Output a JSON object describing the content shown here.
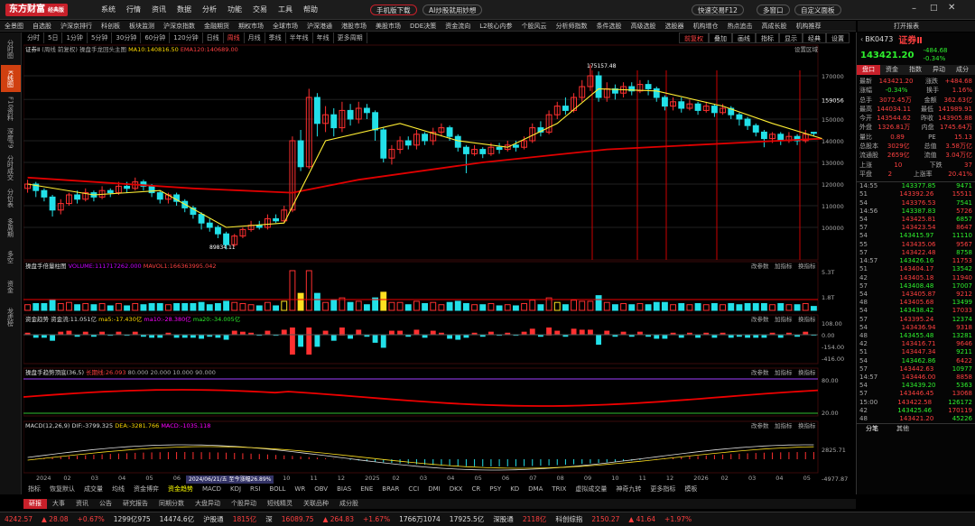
{
  "app": {
    "logo": "东方财富",
    "logo_sub": "经典版"
  },
  "menu": [
    "系统",
    "行情",
    "资讯",
    "数据",
    "分析",
    "功能",
    "交易",
    "工具",
    "帮助"
  ],
  "toolbar": {
    "mobile": "手机版下载",
    "ai": "AI炒股就用妙想",
    "trade_search": "快速交易F12",
    "multi_window": "多窗口",
    "custom": "自定义面板"
  },
  "nav": [
    "全景图",
    "自选股",
    "沪深京排行",
    "科创板",
    "板块监测",
    "沪深京指数",
    "金融期货",
    "期权市场",
    "全球市场",
    "沪深港通",
    "港股市场",
    "美股市场",
    "DDE决策",
    "资金流向",
    "L2核心内参",
    "个股风云",
    "分析师指数",
    "条件选股",
    "高级选股",
    "选股器",
    "机构增仓",
    "热点追击",
    "高成长股",
    "机构推荐"
  ],
  "open_report": "打开报表",
  "timeframes": [
    {
      "label": "分时",
      "on": false
    },
    {
      "label": "5日",
      "on": false
    },
    {
      "label": "1分钟",
      "on": false
    },
    {
      "label": "5分钟",
      "on": false
    },
    {
      "label": "30分钟",
      "on": false
    },
    {
      "label": "60分钟",
      "on": false
    },
    {
      "label": "120分钟",
      "on": false
    },
    {
      "label": "日线",
      "on": false
    },
    {
      "label": "周线",
      "on": true
    },
    {
      "label": "月线",
      "on": false
    },
    {
      "label": "季线",
      "on": false
    },
    {
      "label": "半年线",
      "on": false
    },
    {
      "label": "年线",
      "on": false
    },
    {
      "label": "更多周期",
      "on": false
    }
  ],
  "tools": [
    "前复权",
    "叠加",
    "画线",
    "指标",
    "显示",
    "经典",
    "设置"
  ],
  "left_tabs": [
    {
      "label": "分时图",
      "on": false
    },
    {
      "label": "K线图",
      "on": true
    },
    {
      "label": "F10资料",
      "on": false
    },
    {
      "label": "深度F9",
      "on": false
    },
    {
      "label": "分时成交",
      "on": false
    },
    {
      "label": "分价表",
      "on": false
    },
    {
      "label": "多周期",
      "on": false
    },
    {
      "label": "多空",
      "on": false
    },
    {
      "label": "资金",
      "on": false
    },
    {
      "label": "龙虎榜",
      "on": false
    }
  ],
  "main_legend": {
    "name": "证券Ⅱ",
    "mode": "(周线 前复权)",
    "formula": "操盘手龙回头主图",
    "ma10": "MA10:140816.50",
    "ema": "EMA120:140689.00",
    "settings": "设置区域"
  },
  "price_axis": [
    "170000",
    "159056",
    "150000",
    "140000",
    "130000",
    "120000",
    "110000",
    "100000"
  ],
  "peak_label": "175157.48",
  "low_label": "89834.11",
  "vol_legend": {
    "name": "操盘手倍量柱图",
    "vol": "VOLUME:111717262.000",
    "mavol": "MAVOL1:166363995.042"
  },
  "vol_axis": [
    "5.3T",
    "1.8T"
  ],
  "panel_links": [
    "改参数",
    "加指标",
    "换指标"
  ],
  "cash_legend": {
    "name": "资金趋势",
    "zj": "资金流:11.051亿",
    "ma5": "ma5:-17.430亿",
    "ma10": "ma10:-28.380亿",
    "ma20": "ma20:-34.005亿"
  },
  "cash_axis": [
    "108.00",
    "0.00",
    "-154.00",
    "-416.00"
  ],
  "trend_legend": {
    "name": "操盘手趋势顶底(36,5)",
    "cur": "长期线:26.093",
    "l80": "80.000",
    "l20": "20.000",
    "l10": "10.000",
    "l90": "90.000"
  },
  "trend_axis": [
    "80.00",
    "20.00"
  ],
  "macd_legend": {
    "name": "MACD(12,26,9)",
    "dif": "DIF:-3799.325",
    "dea": "DEA:-3281.766",
    "macd": "MACD:-1035.118"
  },
  "macd_axis": [
    "2825.71",
    "-4977.87"
  ],
  "date_axis": [
    "2024",
    "02",
    "03",
    "04",
    "05",
    "06",
    "07",
    "08",
    "09",
    "10",
    "11",
    "12",
    "2025",
    "02",
    "03",
    "04",
    "05",
    "06",
    "07",
    "08",
    "09",
    "10",
    "11",
    "12",
    "2026",
    "02",
    "03",
    "04",
    "05"
  ],
  "date_tip": "2024/06/21/五 至今涨幅26.89%",
  "indicator_tabs": [
    "指标",
    "恢复默认",
    "成交量",
    "均线",
    "资金博弈",
    "资金趋势",
    "MACD",
    "KDJ",
    "RSI",
    "BOLL",
    "WR",
    "OBV",
    "BIAS",
    "ENE",
    "BRAR",
    "CCI",
    "DMI",
    "DKX",
    "CR",
    "PSY",
    "KD",
    "DMA",
    "TRIX",
    "虚拟成交量",
    "神奇九转",
    "更多指标",
    "模板"
  ],
  "sub_tabs": [
    "研报",
    "大事",
    "资讯",
    "公告",
    "研究报告",
    "同期分数",
    "大盘异动",
    "个股异动",
    "短线精灵",
    "关联品种",
    "成分股"
  ],
  "quote": {
    "code": "BK0473",
    "name": "证券Ⅱ",
    "price": "143421.20",
    "change": "-484.68",
    "pct": "-0.34%",
    "tabs": [
      "盘口",
      "资金",
      "指数",
      "异动",
      "成分"
    ],
    "rows": [
      [
        "最新",
        "143421.20",
        "涨跌",
        "+484.68"
      ],
      [
        "涨幅",
        "-0.34%",
        "换手",
        "1.16%"
      ],
      [
        "总手",
        "3072.45万",
        "金额",
        "362.63亿"
      ],
      [
        "最高",
        "144034.11",
        "最低",
        "141989.91"
      ],
      [
        "今开",
        "143544.62",
        "昨收",
        "143905.88"
      ],
      [
        "外盘",
        "1326.81万",
        "内盘",
        "1745.64万"
      ],
      [
        "量比",
        "0.89",
        "PE",
        "15.13"
      ],
      [
        "总股本",
        "3029亿",
        "总值",
        "3.58万亿"
      ],
      [
        "流通股",
        "2659亿",
        "流值",
        "3.04万亿"
      ],
      [
        "上涨",
        "10",
        "下跌",
        "37"
      ],
      [
        "平盘",
        "2",
        "上涨率",
        "20.41%"
      ]
    ]
  },
  "ticks": [
    [
      "14:55",
      "143377.85",
      "9471"
    ],
    [
      "51",
      "143392.26",
      "15511"
    ],
    [
      "54",
      "143376.53",
      "7541"
    ],
    [
      "14:56",
      "143387.83",
      "5726"
    ],
    [
      "54",
      "143425.81",
      "6857"
    ],
    [
      "57",
      "143423.54",
      "8647"
    ],
    [
      "54",
      "143415.97",
      "11110"
    ],
    [
      "55",
      "143435.06",
      "9567"
    ],
    [
      "57",
      "143422.48",
      "8758"
    ],
    [
      "14:57",
      "143426.16",
      "11753"
    ],
    [
      "51",
      "143404.17",
      "13542"
    ],
    [
      "42",
      "143405.18",
      "11940"
    ],
    [
      "57",
      "143408.48",
      "17007"
    ],
    [
      "54",
      "143405.87",
      "9212"
    ],
    [
      "48",
      "143405.68",
      "13499"
    ],
    [
      "54",
      "143438.42",
      "17033"
    ],
    [
      "57",
      "143395.24",
      "12374"
    ],
    [
      "54",
      "143436.94",
      "9318"
    ],
    [
      "48",
      "143455.48",
      "13281"
    ],
    [
      "42",
      "143416.71",
      "9646"
    ],
    [
      "51",
      "143447.34",
      "9211"
    ],
    [
      "54",
      "143462.86",
      "6422"
    ],
    [
      "57",
      "143442.63",
      "10977"
    ],
    [
      "14:57",
      "143446.00",
      "8858"
    ],
    [
      "54",
      "143439.20",
      "5363"
    ],
    [
      "57",
      "143446.45",
      "13068"
    ],
    [
      "15:00",
      "143422.58",
      "126172"
    ],
    [
      "42",
      "143425.46",
      "170119"
    ],
    [
      "48",
      "143421.20",
      "45226"
    ]
  ],
  "tick_tabs": [
    "分笔",
    "其他"
  ],
  "status": {
    "idx1": "4242.57",
    "idx1_ch": "▲ 28.08",
    "idx1_p": "+0.67%",
    "idx1_v": "1299亿975",
    "idx2": "14474.6亿",
    "hgt_label": "沪股通",
    "hgt": "1815亿",
    "sz_label": "深",
    "idx3": "16089.75",
    "idx3_ch": "▲ 264.83",
    "idx3_p": "+1.67%",
    "idx3_v": "1766万1074",
    "idx4": "17925.5亿",
    "sgt_label": "深股通",
    "sgt": "2118亿",
    "kc_label": "科创综指",
    "idx5": "2150.27",
    "idx5_ch": "▲ 41.64",
    "idx5_p": "+1.97%"
  },
  "chart_data": {
    "type": "candlestick",
    "price_range": [
      85000,
      180000
    ],
    "peak": 175157.48,
    "low": 89834.11,
    "last": 143421.2,
    "candles": [
      [
        118000,
        120000,
        122000,
        116000
      ],
      [
        120000,
        117000,
        121000,
        114000
      ],
      [
        117000,
        114000,
        118000,
        112000
      ],
      [
        114000,
        108000,
        115000,
        105000
      ],
      [
        108000,
        111000,
        113000,
        106000
      ],
      [
        111000,
        115000,
        116000,
        110000
      ],
      [
        115000,
        113000,
        117000,
        111000
      ],
      [
        113000,
        116000,
        118000,
        112000
      ],
      [
        116000,
        114000,
        117000,
        112000
      ],
      [
        114000,
        117000,
        119000,
        113000
      ],
      [
        117000,
        116000,
        118000,
        114000
      ],
      [
        116000,
        119000,
        121000,
        115000
      ],
      [
        119000,
        118000,
        121000,
        116000
      ],
      [
        118000,
        121000,
        123000,
        117000
      ],
      [
        121000,
        119000,
        122000,
        117000
      ],
      [
        119000,
        116000,
        120000,
        114000
      ],
      [
        116000,
        113000,
        117000,
        111000
      ],
      [
        113000,
        115000,
        116000,
        111000
      ],
      [
        115000,
        112000,
        116000,
        110000
      ],
      [
        112000,
        109000,
        113000,
        107000
      ],
      [
        109000,
        106000,
        110000,
        104000
      ],
      [
        106000,
        102000,
        107000,
        99000
      ],
      [
        102000,
        100000,
        104000,
        98000
      ],
      [
        100000,
        97000,
        101000,
        95000
      ],
      [
        97000,
        92000,
        98000,
        89834
      ],
      [
        92000,
        96000,
        97000,
        91000
      ],
      [
        96000,
        99000,
        100000,
        95000
      ],
      [
        99000,
        101000,
        103000,
        98000
      ],
      [
        101000,
        100000,
        103000,
        99000
      ],
      [
        100000,
        104000,
        106000,
        99000
      ],
      [
        104000,
        103000,
        106000,
        102000
      ],
      [
        103000,
        108000,
        110000,
        102000
      ],
      [
        108000,
        140000,
        142000,
        107000
      ],
      [
        140000,
        128000,
        145000,
        126000
      ],
      [
        128000,
        160000,
        164000,
        127000
      ],
      [
        160000,
        148000,
        162000,
        142000
      ],
      [
        148000,
        152000,
        156000,
        144000
      ],
      [
        152000,
        146000,
        155000,
        142000
      ],
      [
        146000,
        154000,
        158000,
        144000
      ],
      [
        154000,
        150000,
        157000,
        147000
      ],
      [
        150000,
        155000,
        158000,
        148000
      ],
      [
        155000,
        153000,
        157000,
        150000
      ],
      [
        153000,
        145000,
        154000,
        140000
      ],
      [
        145000,
        132000,
        146000,
        130000
      ],
      [
        132000,
        136000,
        138000,
        129000
      ],
      [
        136000,
        140000,
        142000,
        134000
      ],
      [
        140000,
        138000,
        142000,
        136000
      ],
      [
        138000,
        143000,
        145000,
        136000
      ],
      [
        143000,
        140000,
        144000,
        138000
      ],
      [
        140000,
        144000,
        146000,
        138000
      ],
      [
        144000,
        146000,
        148000,
        142000
      ],
      [
        146000,
        142000,
        147000,
        140000
      ],
      [
        142000,
        137000,
        143000,
        135000
      ],
      [
        137000,
        134000,
        138000,
        125000
      ],
      [
        134000,
        136000,
        138000,
        133000
      ],
      [
        136000,
        134000,
        137000,
        132000
      ],
      [
        134000,
        137000,
        139000,
        133000
      ],
      [
        137000,
        136000,
        139000,
        134000
      ],
      [
        136000,
        138000,
        140000,
        135000
      ],
      [
        138000,
        137000,
        140000,
        135000
      ],
      [
        137000,
        140000,
        142000,
        136000
      ],
      [
        140000,
        146000,
        148000,
        139000
      ],
      [
        146000,
        144000,
        149000,
        142000
      ],
      [
        144000,
        152000,
        154000,
        143000
      ],
      [
        152000,
        156000,
        158000,
        150000
      ],
      [
        156000,
        154000,
        160000,
        152000
      ],
      [
        154000,
        160000,
        162000,
        153000
      ],
      [
        160000,
        165000,
        168000,
        158000
      ],
      [
        165000,
        170000,
        175157,
        163000
      ],
      [
        170000,
        160000,
        172000,
        158000
      ],
      [
        160000,
        164000,
        167000,
        158000
      ],
      [
        164000,
        162000,
        166000,
        159000
      ],
      [
        162000,
        165000,
        167000,
        160000
      ],
      [
        165000,
        163000,
        167000,
        161000
      ],
      [
        163000,
        166000,
        168000,
        162000
      ],
      [
        166000,
        164000,
        168000,
        161000
      ],
      [
        164000,
        160000,
        165000,
        158000
      ],
      [
        160000,
        156000,
        161000,
        154000
      ],
      [
        156000,
        158000,
        160000,
        154000
      ],
      [
        158000,
        155000,
        160000,
        153000
      ],
      [
        155000,
        157000,
        159000,
        154000
      ],
      [
        157000,
        154000,
        158000,
        152000
      ],
      [
        154000,
        156000,
        158000,
        153000
      ],
      [
        156000,
        153000,
        157000,
        151000
      ],
      [
        153000,
        155000,
        157000,
        152000
      ],
      [
        155000,
        152000,
        156000,
        150000
      ],
      [
        152000,
        150000,
        153000,
        147000
      ],
      [
        150000,
        147000,
        151000,
        145000
      ],
      [
        147000,
        144000,
        148000,
        142000
      ],
      [
        144000,
        141000,
        145000,
        137000
      ],
      [
        141000,
        143000,
        144000,
        139000
      ],
      [
        143000,
        140000,
        144000,
        138000
      ],
      [
        140000,
        142000,
        144000,
        139000
      ],
      [
        142000,
        140000,
        143000,
        138000
      ],
      [
        140000,
        143000,
        145000,
        139000
      ],
      [
        143905,
        143421,
        144034,
        141989
      ]
    ],
    "ema120": [
      [
        0,
        123000
      ],
      [
        20,
        118000
      ],
      [
        32,
        116000
      ],
      [
        40,
        122000
      ],
      [
        55,
        130000
      ],
      [
        70,
        136000
      ],
      [
        96,
        141000
      ]
    ],
    "ma10_series": [
      [
        0,
        120000
      ],
      [
        8,
        115000
      ],
      [
        16,
        117000
      ],
      [
        24,
        100000
      ],
      [
        31,
        102000
      ],
      [
        36,
        140000
      ],
      [
        45,
        148000
      ],
      [
        52,
        140000
      ],
      [
        58,
        137000
      ],
      [
        64,
        148000
      ],
      [
        69,
        164000
      ],
      [
        76,
        163000
      ],
      [
        84,
        156000
      ],
      [
        90,
        148000
      ],
      [
        96,
        141000
      ]
    ]
  }
}
